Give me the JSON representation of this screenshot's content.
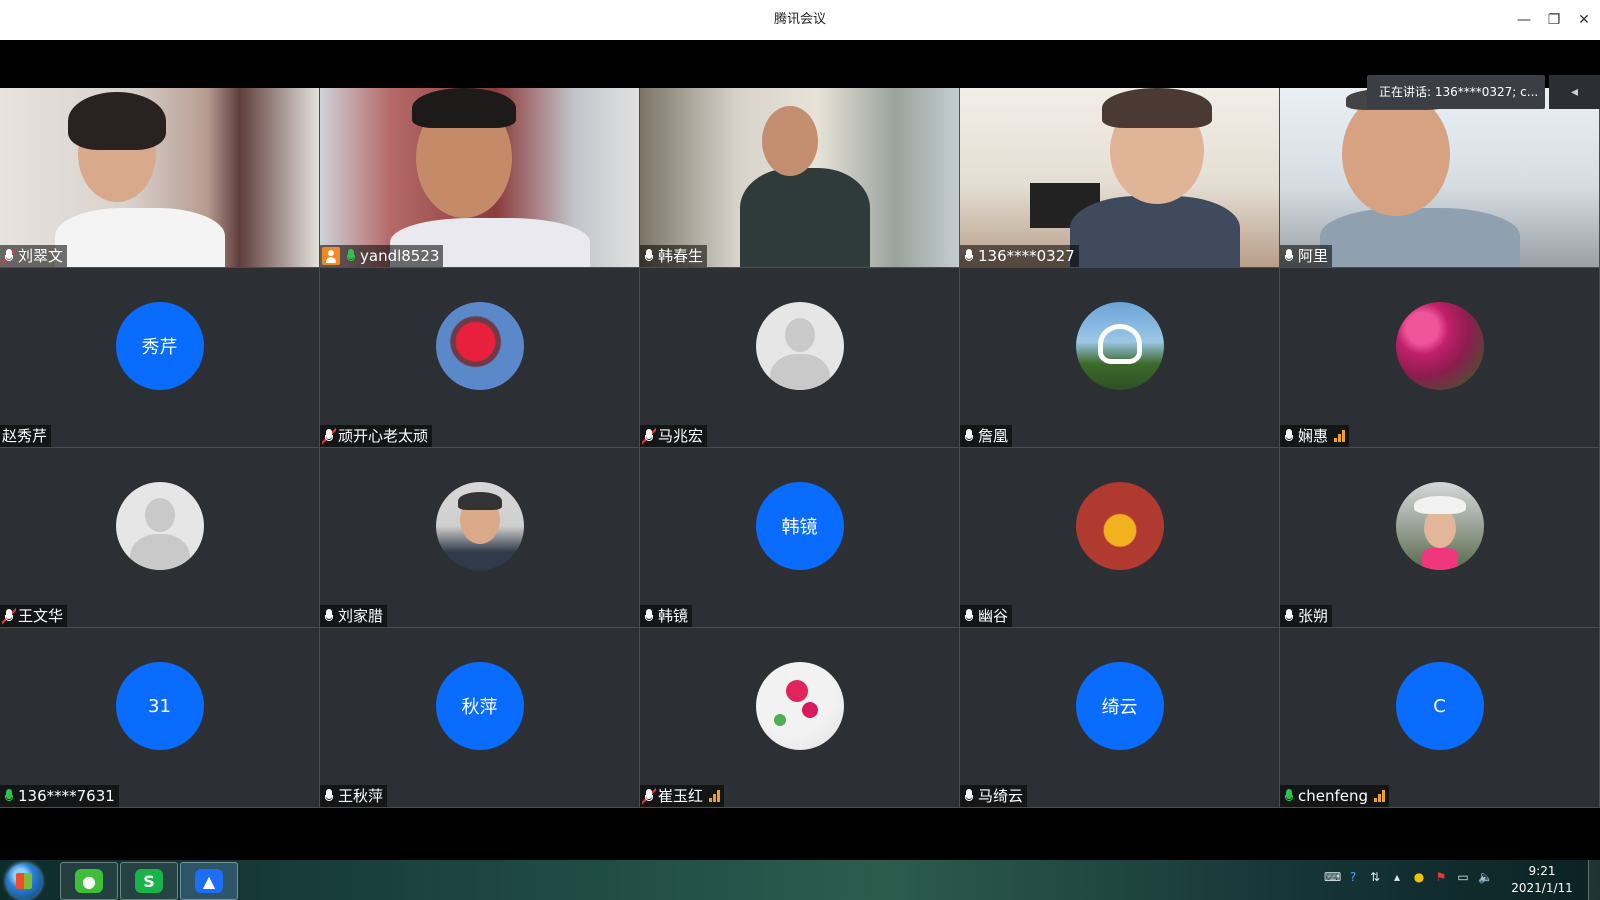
{
  "window": {
    "title": "腾讯会议",
    "minimize_icon": "minimize-icon",
    "restore_icon": "restore-icon",
    "close_icon": "close-icon"
  },
  "speaking_tip": "正在讲话: 136****0327; c...",
  "participants": [
    {
      "name": "刘翠文",
      "type": "video",
      "mic": "muted"
    },
    {
      "name": "yandl8523",
      "type": "video",
      "mic": "active",
      "host": true
    },
    {
      "name": "韩春生",
      "type": "video",
      "mic": "on"
    },
    {
      "name": "136****0327",
      "type": "video",
      "mic": "on",
      "speaking": true
    },
    {
      "name": "阿里",
      "type": "video",
      "mic": "on"
    },
    {
      "name": "赵秀芹",
      "type": "avatar-text",
      "avatar_text": "秀芹",
      "mic": "none"
    },
    {
      "name": "顽开心老太顽",
      "type": "avatar-photo",
      "mic": "muted"
    },
    {
      "name": "马兆宏",
      "type": "avatar-default",
      "mic": "muted"
    },
    {
      "name": "詹凰",
      "type": "avatar-photo",
      "mic": "on"
    },
    {
      "name": "娴惠",
      "type": "avatar-photo",
      "mic": "on",
      "signal": true
    },
    {
      "name": "王文华",
      "type": "avatar-default",
      "mic": "muted"
    },
    {
      "name": "刘家腊",
      "type": "avatar-photo",
      "mic": "on"
    },
    {
      "name": "韩镜",
      "type": "avatar-text",
      "avatar_text": "韩镜",
      "mic": "on"
    },
    {
      "name": "幽谷",
      "type": "avatar-photo",
      "mic": "on"
    },
    {
      "name": "张朔",
      "type": "avatar-photo",
      "mic": "on"
    },
    {
      "name": "136****7631",
      "type": "avatar-text",
      "avatar_text": "31",
      "mic": "active"
    },
    {
      "name": "王秋萍",
      "type": "avatar-text",
      "avatar_text": "秋萍",
      "mic": "on"
    },
    {
      "name": "崔玉红",
      "type": "avatar-photo",
      "mic": "muted",
      "signal": true
    },
    {
      "name": "马绮云",
      "type": "avatar-text",
      "avatar_text": "绮云",
      "mic": "on"
    },
    {
      "name": "chenfeng",
      "type": "avatar-text",
      "avatar_text": "C",
      "mic": "active",
      "signal": true
    }
  ],
  "colors": {
    "avatar_blue": "#0a6cff",
    "speaking_border": "#1fc25d",
    "tile_bg": "#2c2f33",
    "signal": "#f0a030"
  },
  "taskbar": {
    "apps": [
      {
        "name": "start",
        "icon": "windows-start-icon"
      },
      {
        "name": "wechat",
        "icon": "wechat-icon"
      },
      {
        "name": "wps",
        "icon": "wps-s-icon",
        "glyph": "S"
      },
      {
        "name": "tencent-meeting",
        "icon": "tencent-meeting-icon"
      }
    ],
    "time": "9:21",
    "date": "2021/1/11"
  }
}
